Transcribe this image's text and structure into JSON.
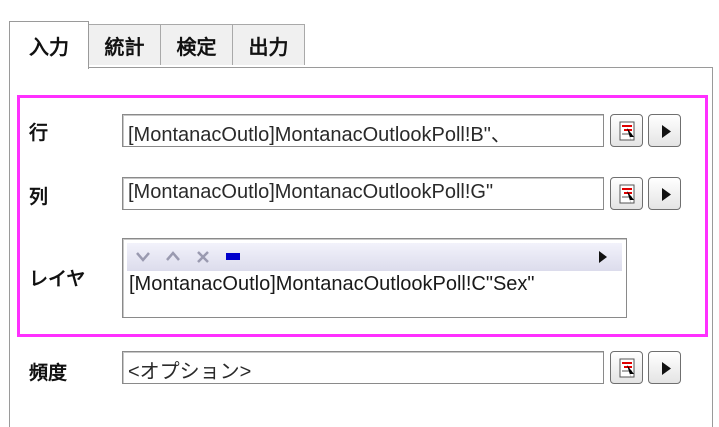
{
  "tabs": [
    {
      "label": "入力",
      "active": true
    },
    {
      "label": "統計",
      "active": false
    },
    {
      "label": "検定",
      "active": false
    },
    {
      "label": "出力",
      "active": false
    }
  ],
  "fields": {
    "row": {
      "label": "行",
      "value": "[MontanacOutlo]MontanacOutlookPoll!B\"、"
    },
    "column": {
      "label": "列",
      "value": "[MontanacOutlo]MontanacOutlookPoll!G\""
    },
    "layer": {
      "label": "レイヤ",
      "entries": [
        "[MontanacOutlo]MontanacOutlookPoll!C\"Sex\""
      ]
    },
    "frequency": {
      "label": "頻度",
      "value": "<オプション>"
    }
  },
  "icons": {
    "select_button": "range-select-icon",
    "menu_button": "play-arrow-icon",
    "layer_toolbar": [
      "move-down-icon",
      "move-up-icon",
      "remove-icon",
      "add-icon",
      "menu-arrow-icon"
    ]
  },
  "colors": {
    "highlight_border": "#ff30ff",
    "add_icon": "#0000cc",
    "select_icon_red": "#e00000"
  }
}
